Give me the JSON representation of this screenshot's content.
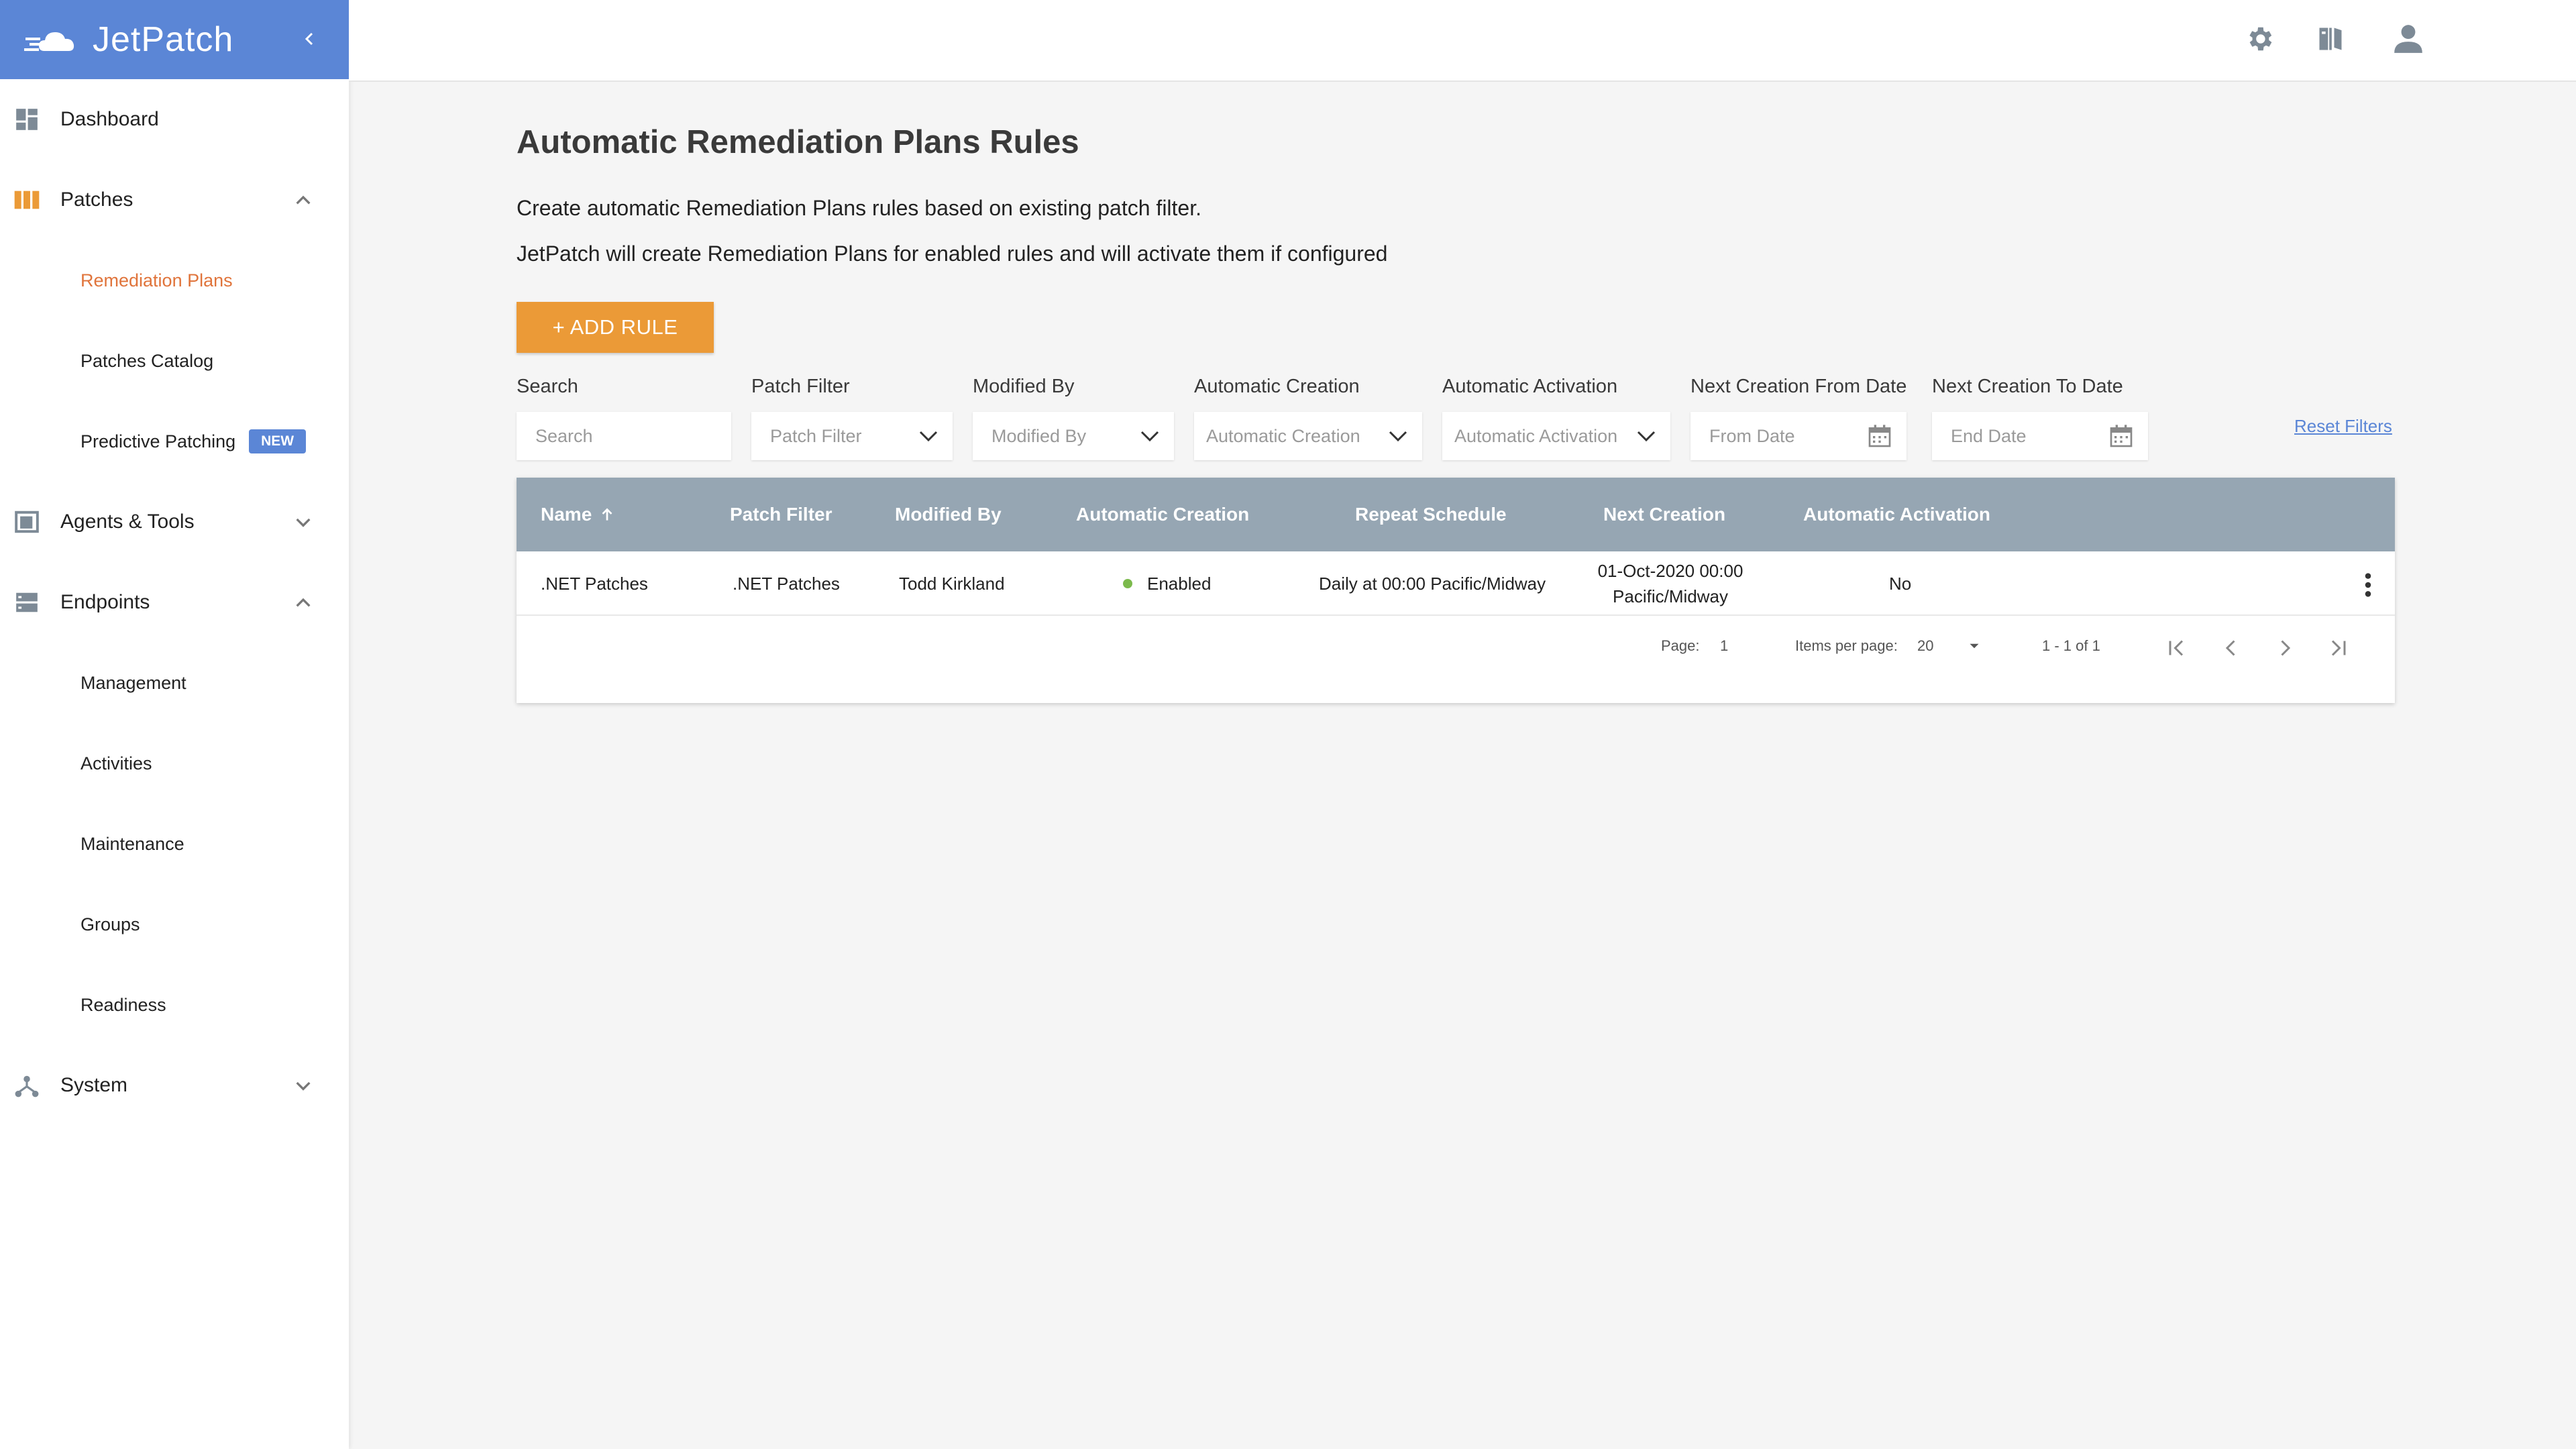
{
  "brand": {
    "name": "JetPatch"
  },
  "sidebar": {
    "items": [
      {
        "label": "Dashboard"
      },
      {
        "label": "Patches"
      },
      {
        "label": "Remediation Plans"
      },
      {
        "label": "Patches Catalog"
      },
      {
        "label": "Predictive Patching",
        "badge": "NEW"
      },
      {
        "label": "Agents & Tools"
      },
      {
        "label": "Endpoints"
      },
      {
        "label": "Management"
      },
      {
        "label": "Activities"
      },
      {
        "label": "Maintenance"
      },
      {
        "label": "Groups"
      },
      {
        "label": "Readiness"
      },
      {
        "label": "System"
      }
    ]
  },
  "page": {
    "title": "Automatic Remediation Plans Rules",
    "desc1": "Create automatic Remediation Plans rules based on existing patch filter.",
    "desc2": "JetPatch will create Remediation Plans for enabled rules and will activate them if configured",
    "add_button": "+ ADD RULE"
  },
  "filters": {
    "search": {
      "label": "Search",
      "placeholder": "Search"
    },
    "patch_filter": {
      "label": "Patch Filter",
      "placeholder": "Patch Filter"
    },
    "modified_by": {
      "label": "Modified By",
      "placeholder": "Modified By"
    },
    "auto_creation": {
      "label": "Automatic Creation",
      "placeholder": "Automatic Creation"
    },
    "auto_activation": {
      "label": "Automatic Activation",
      "placeholder": "Automatic Activation"
    },
    "from_date": {
      "label": "Next Creation From Date",
      "placeholder": "From Date"
    },
    "to_date": {
      "label": "Next Creation To Date",
      "placeholder": "End Date"
    },
    "reset": "Reset Filters"
  },
  "table": {
    "columns": [
      "Name",
      "Patch Filter",
      "Modified By",
      "Automatic Creation",
      "Repeat Schedule",
      "Next Creation",
      "Automatic Activation"
    ],
    "rows": [
      {
        "name": ".NET Patches",
        "patch_filter": ".NET Patches",
        "modified_by": "Todd Kirkland",
        "auto_creation": "Enabled",
        "repeat_schedule": "Daily at 00:00 Pacific/Midway",
        "next_creation_line1": "01-Oct-2020 00:00",
        "next_creation_line2": "Pacific/Midway",
        "auto_activation": "No"
      }
    ]
  },
  "paginator": {
    "page_label": "Page:",
    "page_value": "1",
    "items_label": "Items per page:",
    "items_value": "20",
    "range": "1 - 1 of 1"
  },
  "colors": {
    "brand": "#5b86d6",
    "accent": "#eb9a37",
    "active_nav": "#e0743b",
    "table_header": "#96a6b3",
    "enabled_dot": "#7cba4d"
  }
}
